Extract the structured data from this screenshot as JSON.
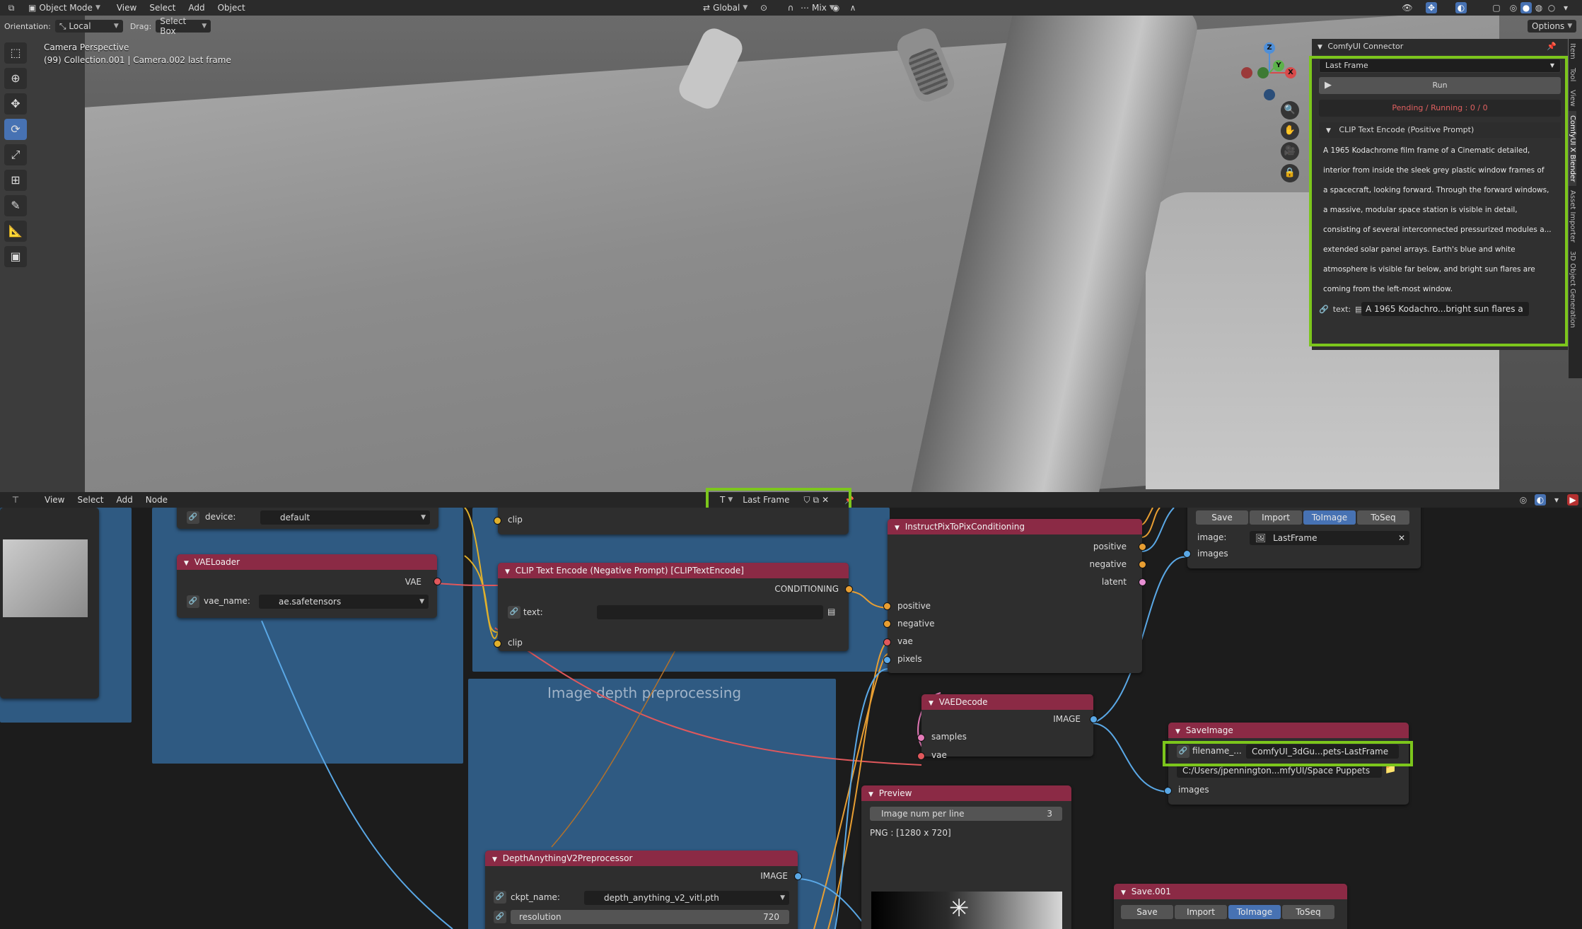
{
  "header": {
    "mode": "Object Mode",
    "menus": [
      "View",
      "Select",
      "Add",
      "Object"
    ],
    "transform_orientation": "Global",
    "snap_mode": "Mix"
  },
  "tool_header": {
    "orientation_label": "Orientation:",
    "orientation_value": "Local",
    "drag_label": "Drag:",
    "drag_value": "Select Box",
    "options_label": "Options"
  },
  "viewport": {
    "view_name": "Camera Perspective",
    "collection_info": "(99) Collection.001 | Camera.002 last frame"
  },
  "gizmo": {
    "x": "X",
    "y": "Y",
    "z": "Z"
  },
  "side_tabs": [
    "Item",
    "Tool",
    "View",
    "ComfyUI X Blender",
    "Asset Importer",
    "3D Object Generation"
  ],
  "comfy_panel": {
    "title": "ComfyUI Connector",
    "workflow": "Last Frame",
    "run_label": "Run",
    "status": "Pending / Running : 0 / 0",
    "section_title": "CLIP Text Encode (Positive Prompt)",
    "prompt_lines": [
      "A 1965 Kodachrome film frame of a Cinematic detailed,",
      "interior from inside the sleek grey plastic window frames of",
      "a spacecraft, looking forward. Through the forward windows,",
      "a massive, modular space station is visible in detail,",
      "consisting of several interconnected pressurized modules a...",
      "extended solar panel arrays. Earth's blue and white",
      "atmosphere is visible far below, and bright sun flares are",
      "coming from the left-most window."
    ],
    "text_label": "text:",
    "text_value": "A 1965 Kodachro...bright sun flares a"
  },
  "node_header": {
    "menus": [
      "View",
      "Select",
      "Add",
      "Node"
    ],
    "tree_name": "Last Frame"
  },
  "nodes": {
    "device_label": "device:",
    "device_value": "default",
    "vae_loader": {
      "title": "VAELoader",
      "out": "VAE",
      "field_label": "vae_name:",
      "field_value": "ae.safetensors"
    },
    "clip_top": {
      "input": "clip"
    },
    "clip_neg": {
      "title": "CLIP Text Encode (Negative Prompt) [CLIPTextEncode]",
      "out": "CONDITIONING",
      "text_label": "text:",
      "input": "clip"
    },
    "instruct": {
      "title": "InstructPixToPixConditioning",
      "outs": [
        "positive",
        "negative",
        "latent"
      ],
      "ins": [
        "positive",
        "negative",
        "vae",
        "pixels"
      ]
    },
    "save_top": {
      "buttons": [
        "Save",
        "Import",
        "ToImage",
        "ToSeq"
      ],
      "image_label": "image:",
      "image_value": "LastFrame",
      "input": "images"
    },
    "depth_frame": "Image depth preprocessing",
    "vae_decode": {
      "title": "VAEDecode",
      "out": "IMAGE",
      "ins": [
        "samples",
        "vae"
      ]
    },
    "save_image": {
      "title": "SaveImage",
      "field_label": "filename_...",
      "field_value": "ComfyUI_3dGu...pets-LastFrame",
      "path": "C:/Users/jpennington...mfyUI/Space Puppets",
      "input": "images"
    },
    "preview": {
      "title": "Preview",
      "num_label": "Image num per line",
      "num_value": "3",
      "info": "PNG : [1280 x 720]"
    },
    "depth": {
      "title": "DepthAnythingV2Preprocessor",
      "out": "IMAGE",
      "ckpt_label": "ckpt_name:",
      "ckpt_value": "depth_anything_v2_vitl.pth",
      "res_label": "resolution",
      "res_value": "720"
    },
    "save001": {
      "title": "Save.001",
      "buttons": [
        "Save",
        "Import",
        "ToImage",
        "ToSeq"
      ]
    }
  },
  "colors": {
    "accent": "#4772b3",
    "highlight_box": "#7cc61c",
    "node_header": "#8b2a45",
    "frame": "#2f5a82",
    "status_red": "#e06060"
  }
}
